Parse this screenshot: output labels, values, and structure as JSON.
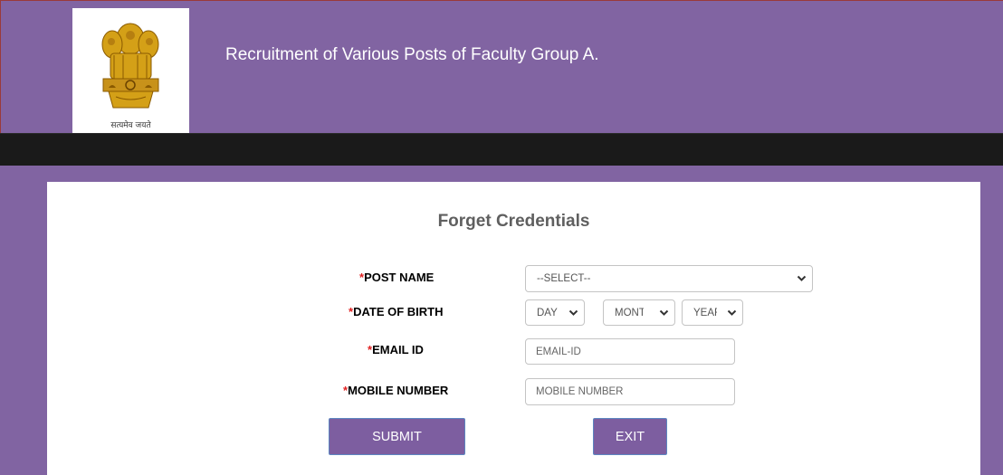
{
  "header": {
    "title": "Recruitment of Various Posts of Faculty Group A.",
    "emblem_caption": "सत्यमेव जयते",
    "emblem_icon": "national-emblem-icon"
  },
  "form": {
    "title": "Forget Credentials",
    "required_mark": "*",
    "fields": {
      "post_name": {
        "label": "POST NAME",
        "selected": "--SELECT--"
      },
      "dob": {
        "label": "DATE OF BIRTH",
        "day": "DAY",
        "month": "MONTH",
        "year": "YEAR"
      },
      "email": {
        "label": "EMAIL ID",
        "placeholder": "EMAIL-ID"
      },
      "mobile": {
        "label": "MOBILE NUMBER",
        "placeholder": "MOBILE NUMBER"
      }
    },
    "buttons": {
      "submit": "SUBMIT",
      "exit": "EXIT"
    }
  },
  "colors": {
    "page_background": "#8164a2",
    "navbar": "#1a1a1a",
    "button": "#7d5ea0",
    "required": "#e02020"
  }
}
